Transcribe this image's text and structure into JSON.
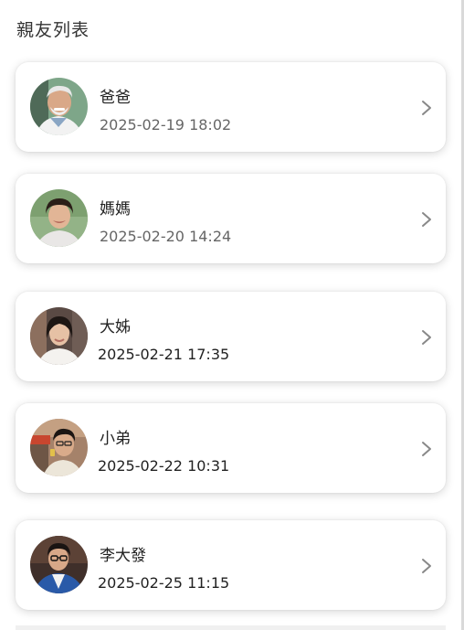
{
  "page": {
    "title": "親友列表"
  },
  "contacts": [
    {
      "name": "爸爸",
      "time": "2025-02-19 18:02",
      "avatar_icon": "elderly-man-avatar"
    },
    {
      "name": "媽媽",
      "time": "2025-02-20 14:24",
      "avatar_icon": "elderly-woman-avatar"
    },
    {
      "name": "大姊",
      "time": "2025-02-21  17:35",
      "avatar_icon": "young-woman-avatar"
    },
    {
      "name": "小弟",
      "time": "2025-02-22  10:31",
      "avatar_icon": "young-man-avatar"
    },
    {
      "name": "李大發",
      "time": "2025-02-25  11:15",
      "avatar_icon": "businessman-avatar"
    }
  ],
  "icons": {
    "chevron": "chevron-right-icon"
  },
  "colors": {
    "card_background": "#ffffff",
    "chevron": "#888888",
    "primary_text": "#222222",
    "secondary_text": "#666666"
  }
}
